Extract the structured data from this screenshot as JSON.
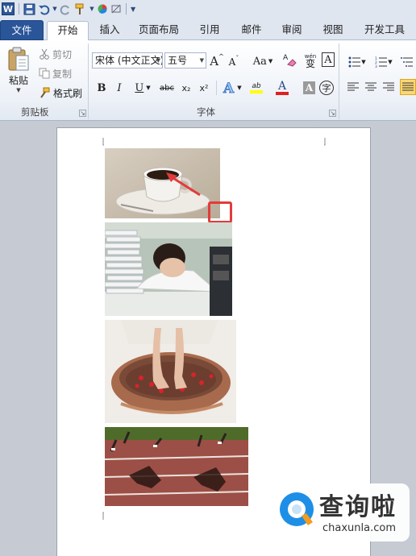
{
  "quick_access": {
    "icons": [
      "word-logo-icon",
      "save-icon",
      "undo-icon",
      "redo-icon",
      "format-painter-icon",
      "color-icon",
      "clear-format-icon",
      "customize-icon"
    ],
    "word_logo": "W"
  },
  "tabs": [
    "文件",
    "开始",
    "插入",
    "页面布局",
    "引用",
    "邮件",
    "审阅",
    "视图",
    "开发工具"
  ],
  "active_tab": "开始",
  "clipboard": {
    "paste_label": "粘贴",
    "cut_label": "剪切",
    "copy_label": "复制",
    "format_painter_label": "格式刷",
    "group_label": "剪贴板"
  },
  "font": {
    "font_name": "宋体 (中文正文)",
    "font_size": "五号",
    "grow_label": "A",
    "shrink_label": "A",
    "case_label": "Aa",
    "phonetic_label": "wén",
    "border_char_label": "A",
    "bold_label": "B",
    "italic_label": "I",
    "underline_label": "U",
    "strike_label": "abc",
    "subscript_label": "x₂",
    "superscript_label": "x²",
    "highlight_label": "ab",
    "font_color_label": "A",
    "shading_label": "A",
    "enclose_label": "字",
    "group_label": "字体"
  },
  "colors": {
    "file_tab": "#2a5599",
    "highlight": "#ffff00",
    "font_color": "#e02020",
    "handle": "#e23b3b",
    "watermark_accent": "#1e8fe6"
  },
  "watermark": {
    "title": "查询啦",
    "subtitle": "chaxunla.com"
  }
}
